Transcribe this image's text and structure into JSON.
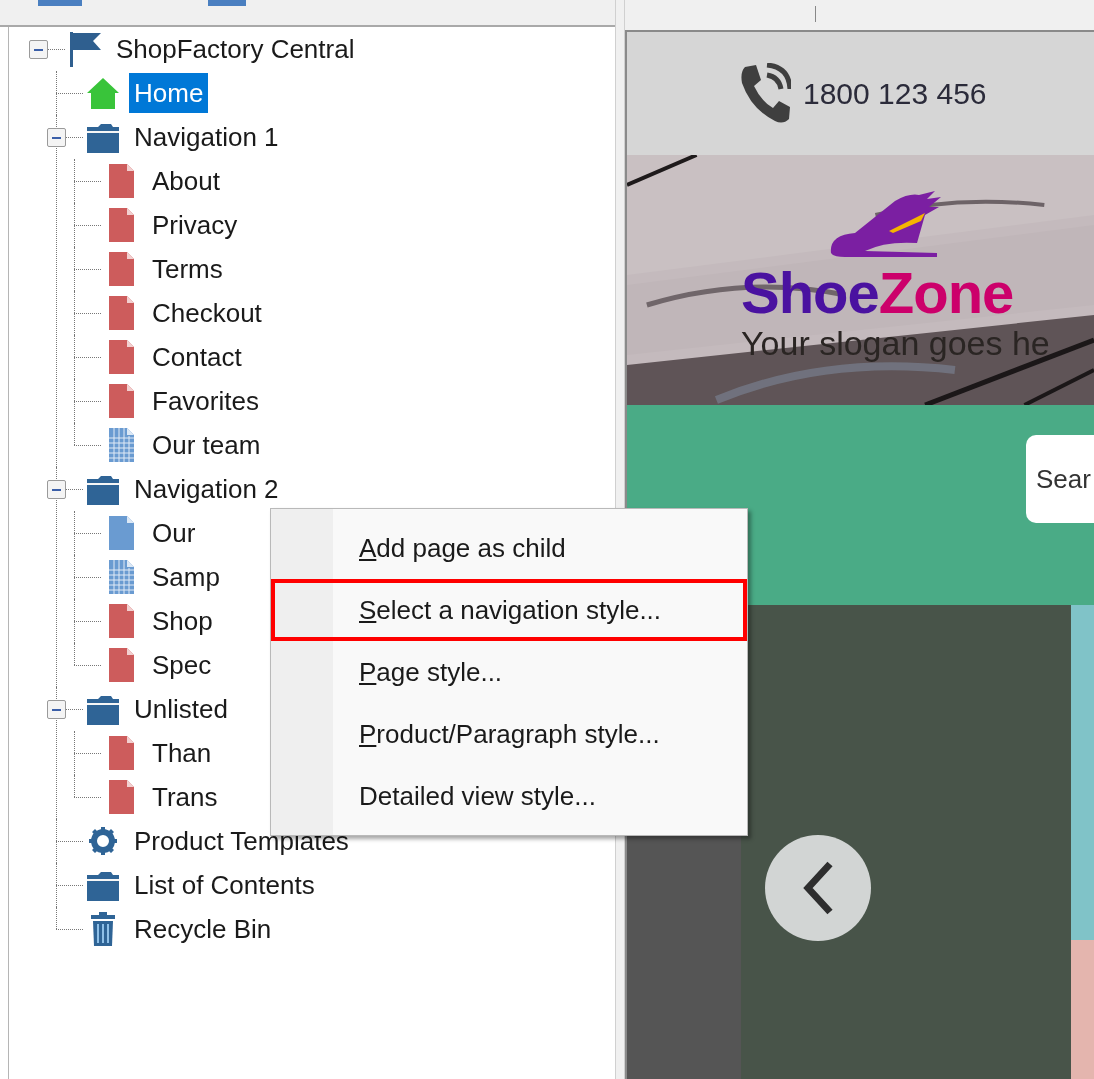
{
  "tree": [
    {
      "label": "ShopFactory Central",
      "kind": "site",
      "expanded": true,
      "selected": false,
      "children": [
        {
          "label": "Home",
          "kind": "home",
          "selected": true
        },
        {
          "label": "Navigation 1",
          "kind": "folder",
          "expanded": true,
          "selected": false,
          "children": [
            {
              "label": "About",
              "kind": "page",
              "selected": false
            },
            {
              "label": "Privacy",
              "kind": "page",
              "selected": false
            },
            {
              "label": "Terms",
              "kind": "page",
              "selected": false
            },
            {
              "label": "Checkout",
              "kind": "page",
              "selected": false
            },
            {
              "label": "Contact",
              "kind": "page",
              "selected": false
            },
            {
              "label": "Favorites",
              "kind": "page",
              "selected": false
            },
            {
              "label": "Our team",
              "kind": "grid_page",
              "selected": false
            }
          ]
        },
        {
          "label": "Navigation 2",
          "kind": "folder",
          "expanded": true,
          "selected": false,
          "children": [
            {
              "label": "Our",
              "kind": "blue_page",
              "selected": false
            },
            {
              "label": "Samp",
              "kind": "grid_page",
              "selected": false
            },
            {
              "label": "Shop",
              "kind": "page",
              "selected": false
            },
            {
              "label": "Spec",
              "kind": "page",
              "selected": false
            }
          ]
        },
        {
          "label": "Unlisted",
          "kind": "folder",
          "expanded": true,
          "selected": false,
          "children": [
            {
              "label": "Than",
              "kind": "page",
              "selected": false
            },
            {
              "label": "Trans",
              "kind": "page",
              "selected": false
            }
          ]
        },
        {
          "label": "Product Templates",
          "kind": "templates",
          "selected": false
        },
        {
          "label": "List of Contents",
          "kind": "folder",
          "selected": false
        },
        {
          "label": "Recycle Bin",
          "kind": "bin",
          "selected": false
        }
      ]
    }
  ],
  "context_menu": {
    "items": [
      {
        "label": "Add page as child",
        "underline_first": true,
        "selected": false
      },
      {
        "label": "Select a navigation style...",
        "underline_first": true,
        "selected": true
      },
      {
        "label": "Page style...",
        "underline_first": true,
        "selected": false
      },
      {
        "label": "Product/Paragraph style...",
        "underline_first": true,
        "selected": false
      },
      {
        "label": "Detailed view style...",
        "underline_first": false,
        "selected": false
      }
    ]
  },
  "preview": {
    "phone": "1800 123 456",
    "hero": {
      "kind": "picture",
      "logo_first": "Shoe",
      "logo_second": "Zone",
      "slogan": "Your slogan goes he"
    },
    "search": {
      "placeholder": "Sear"
    }
  }
}
